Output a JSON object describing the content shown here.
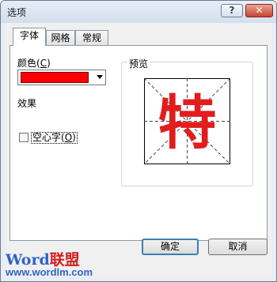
{
  "window": {
    "title": "选项",
    "help_label": "?",
    "close_label": "✕"
  },
  "tabs": [
    {
      "label": "字体",
      "active": true
    },
    {
      "label": "网格",
      "active": false
    },
    {
      "label": "常规",
      "active": false
    }
  ],
  "font_tab": {
    "color_label": "颜色",
    "color_shortcut": "C",
    "color_value": "#ff0000",
    "effects_label": "效果",
    "hollow_label": "空心字",
    "hollow_shortcut": "O",
    "hollow_checked": false,
    "preview_label": "预览",
    "preview_char": "特",
    "preview_color": "#e11d1d"
  },
  "buttons": {
    "ok": "确定",
    "cancel": "取消"
  },
  "watermark": {
    "brand_a": "Word",
    "brand_b": "联盟",
    "url": "www.wordlm.com"
  }
}
